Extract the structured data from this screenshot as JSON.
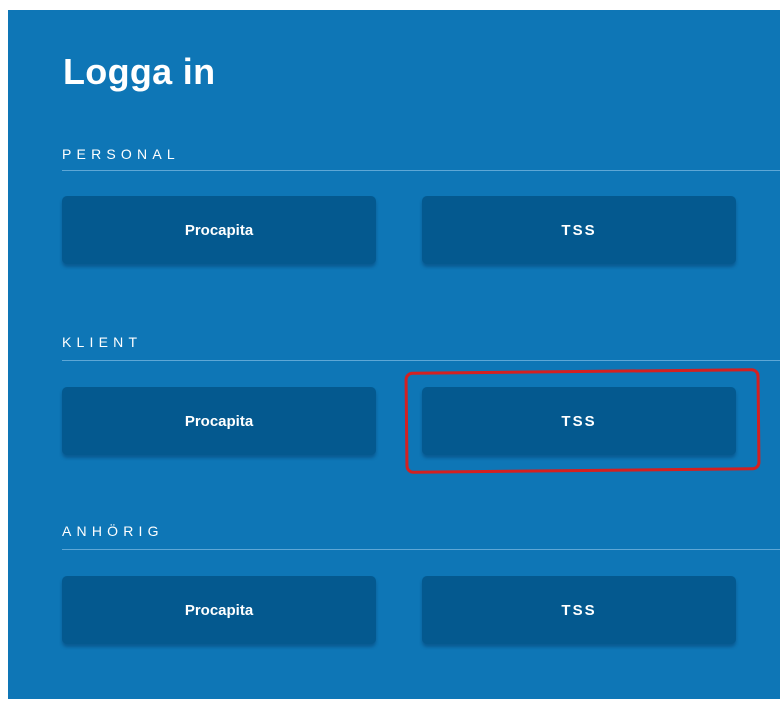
{
  "login": {
    "title": "Logga in",
    "sections": [
      {
        "label": "PERSONAL",
        "buttons": [
          "Procapita",
          "TSS"
        ]
      },
      {
        "label": "KLIENT",
        "buttons": [
          "Procapita",
          "TSS"
        ]
      },
      {
        "label": "ANHÖRIG",
        "buttons": [
          "Procapita",
          "TSS"
        ]
      }
    ]
  },
  "colors": {
    "panel_background": "#0e76b6",
    "button_background": "#04598f",
    "annotation_outline": "#d42020"
  }
}
